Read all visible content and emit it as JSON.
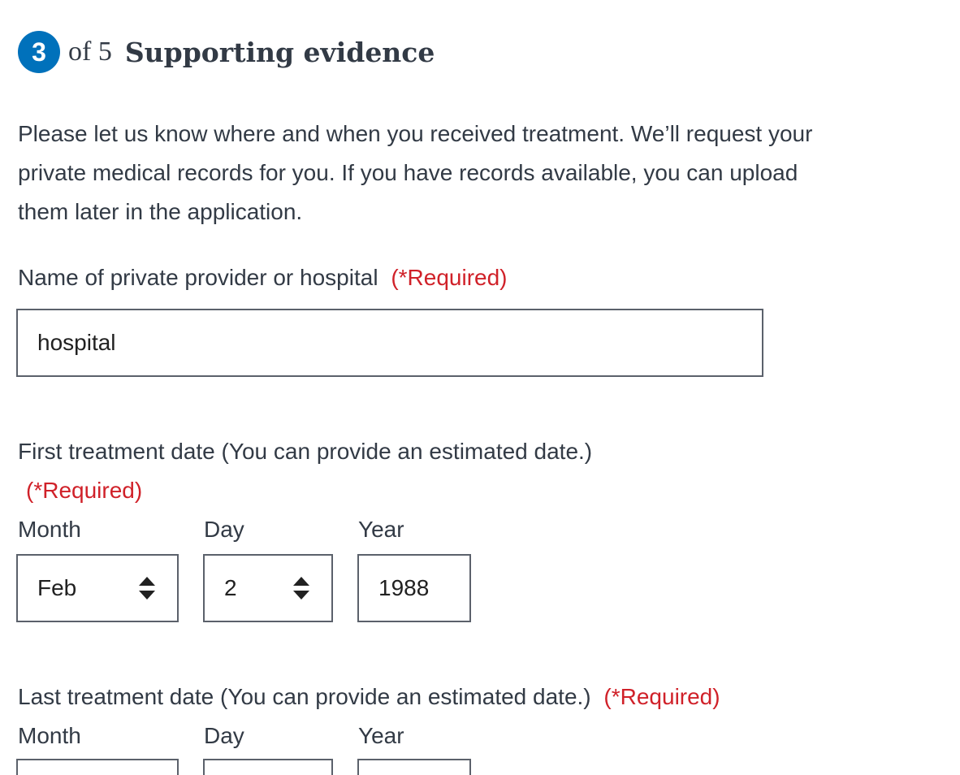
{
  "step": {
    "number": "3",
    "of_text": "of 5",
    "title": "Supporting evidence"
  },
  "intro": "Please let us know where and when you received treatment. We’ll request your private medical records for you. If you have records available, you can upload them later in the application.",
  "provider": {
    "label": "Name of private provider or hospital",
    "required": "(*Required)",
    "value": "hospital"
  },
  "first_date": {
    "label": "First treatment date (You can provide an estimated date.)",
    "required": "(*Required)",
    "month_label": "Month",
    "day_label": "Day",
    "year_label": "Year",
    "month_value": "Feb",
    "day_value": "2",
    "year_value": "1988"
  },
  "last_date": {
    "label": "Last treatment date (You can provide an estimated date.)",
    "required": "(*Required)",
    "month_label": "Month",
    "day_label": "Day",
    "year_label": "Year"
  },
  "colors": {
    "badge": "#0071bb",
    "required": "#d02129",
    "text": "#323a45",
    "border": "#5b616b"
  },
  "icons": {
    "select_arrows": "up-down-triangle-icon"
  }
}
